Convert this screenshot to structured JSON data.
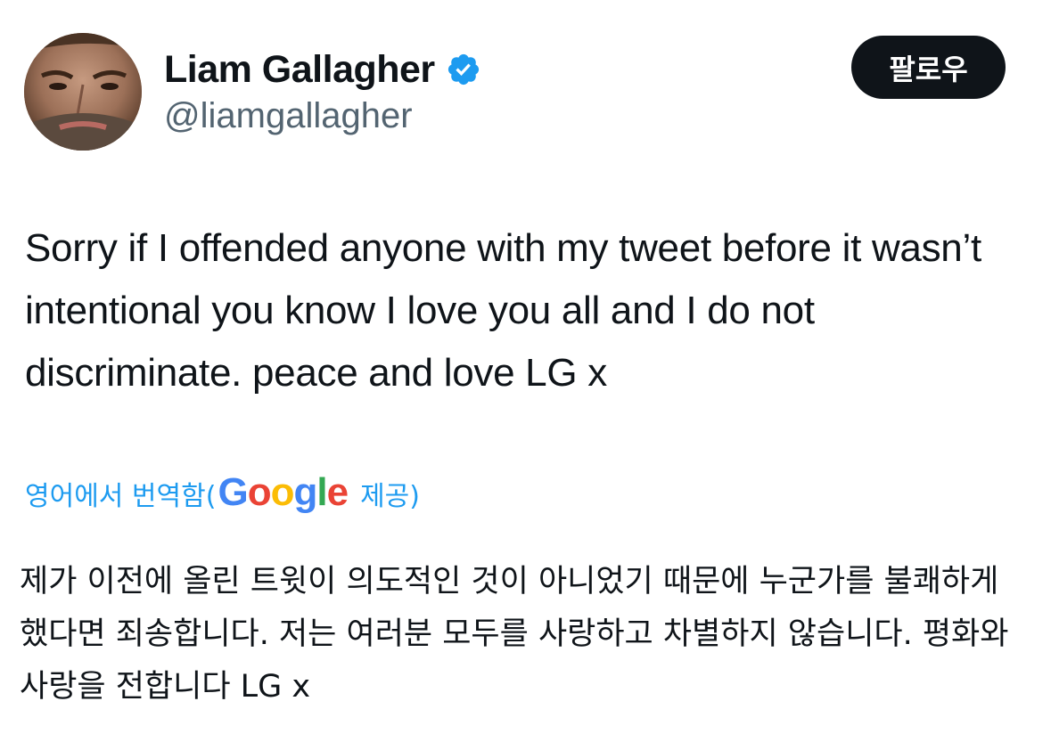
{
  "author": {
    "display_name": "Liam Gallagher",
    "handle": "@liamgallagher",
    "verified": true,
    "avatar": "avatar-photo"
  },
  "actions": {
    "follow_label": "팔로우"
  },
  "tweet": {
    "text": "Sorry if I offended anyone with my tweet before it wasn’t intentional you know I love you all and I do not discriminate. peace and love LG x"
  },
  "translation": {
    "prefix": "영어에서 번역함(",
    "provider_logo": "Google",
    "suffix": "제공)",
    "text": "제가 이전에 올린 트윗이 의도적인 것이 아니었기 때문에 누군가를 불쾌하게 했다면 죄송합니다. 저는 여러분 모두를 사랑하고 차별하지 않습니다. 평화와 사랑을 전합니다 LG x"
  },
  "colors": {
    "link": "#1d9bf0",
    "verified_badge": "#1d9bf0",
    "text_primary": "#0f1419",
    "text_secondary": "#536471",
    "follow_button_bg": "#0f1419"
  },
  "icons": {
    "verified": "verified-badge-icon",
    "google": "google-logo"
  }
}
